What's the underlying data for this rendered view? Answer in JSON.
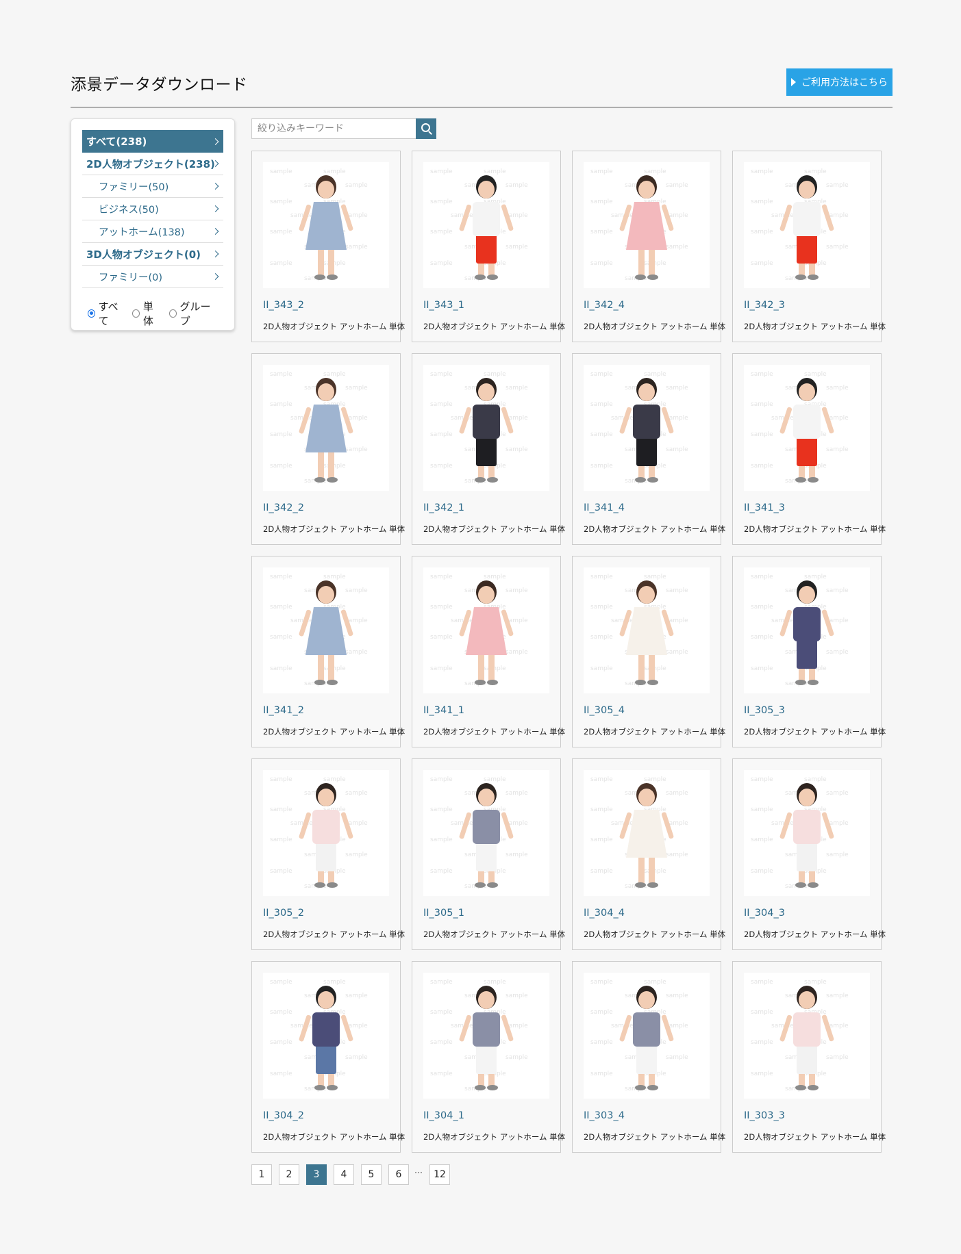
{
  "header": {
    "title": "添景データダウンロード",
    "help_label": "ご利用方法はこちら"
  },
  "sidebar": {
    "categories": [
      {
        "label": "すべて(238)",
        "level": "top",
        "active": true
      },
      {
        "label": "2D人物オブジェクト(238)",
        "level": "top",
        "active": false
      },
      {
        "label": "ファミリー(50)",
        "level": "sub",
        "active": false
      },
      {
        "label": "ビジネス(50)",
        "level": "sub",
        "active": false
      },
      {
        "label": "アットホーム(138)",
        "level": "sub",
        "active": false
      },
      {
        "label": "3D人物オブジェクト(0)",
        "level": "top",
        "active": false
      },
      {
        "label": "ファミリー(0)",
        "level": "sub",
        "active": false
      }
    ],
    "filters": [
      {
        "label": "すべて",
        "checked": true
      },
      {
        "label": "単体",
        "checked": false
      },
      {
        "label": "グループ",
        "checked": false
      }
    ]
  },
  "search": {
    "placeholder": "絞り込みキーワード",
    "value": ""
  },
  "items": [
    {
      "title": "II_343_2",
      "tags": "2D人物オブジェクト アットホーム 単体",
      "figure": {
        "top": "#9fb4d0",
        "bottom": "#9fb4d0",
        "skin": "#f2cdb4",
        "hair": "#4a3328",
        "dress": true
      }
    },
    {
      "title": "II_343_1",
      "tags": "2D人物オブジェクト アットホーム 単体",
      "figure": {
        "top": "#f4f4f4",
        "bottom": "#e8321e",
        "skin": "#f2cdb4",
        "hair": "#222222",
        "dress": false
      }
    },
    {
      "title": "II_342_4",
      "tags": "2D人物オブジェクト アットホーム 単体",
      "figure": {
        "top": "#f3b9bd",
        "bottom": "#e4c3b8",
        "skin": "#f2cdb4",
        "hair": "#3b2a22",
        "dress": true
      }
    },
    {
      "title": "II_342_3",
      "tags": "2D人物オブジェクト アットホーム 単体",
      "figure": {
        "top": "#f4f4f4",
        "bottom": "#e8321e",
        "skin": "#f2cdb4",
        "hair": "#222222",
        "dress": false
      }
    },
    {
      "title": "II_342_2",
      "tags": "2D人物オブジェクト アットホーム 単体",
      "figure": {
        "top": "#9fb4d0",
        "bottom": "#9fb4d0",
        "skin": "#f2cdb4",
        "hair": "#4a3328",
        "dress": true
      }
    },
    {
      "title": "II_342_1",
      "tags": "2D人物オブジェクト アットホーム 単体",
      "figure": {
        "top": "#3a3a48",
        "bottom": "#1e1e22",
        "skin": "#f2cdb4",
        "hair": "#2c2420",
        "dress": false
      }
    },
    {
      "title": "II_341_4",
      "tags": "2D人物オブジェクト アットホーム 単体",
      "figure": {
        "top": "#3a3a48",
        "bottom": "#1e1e22",
        "skin": "#f2cdb4",
        "hair": "#2c2420",
        "dress": false
      }
    },
    {
      "title": "II_341_3",
      "tags": "2D人物オブジェクト アットホーム 単体",
      "figure": {
        "top": "#f4f4f4",
        "bottom": "#e8321e",
        "skin": "#f2cdb4",
        "hair": "#222222",
        "dress": false
      }
    },
    {
      "title": "II_341_2",
      "tags": "2D人物オブジェクト アットホーム 単体",
      "figure": {
        "top": "#9fb4d0",
        "bottom": "#9fb4d0",
        "skin": "#f2cdb4",
        "hair": "#4a3328",
        "dress": true
      }
    },
    {
      "title": "II_341_1",
      "tags": "2D人物オブジェクト アットホーム 単体",
      "figure": {
        "top": "#f3b9bd",
        "bottom": "#e4c3b8",
        "skin": "#f2cdb4",
        "hair": "#3b2a22",
        "dress": true
      }
    },
    {
      "title": "II_305_4",
      "tags": "2D人物オブジェクト アットホーム 単体",
      "figure": {
        "top": "#f6f1ea",
        "bottom": "#e7c8b9",
        "skin": "#f2cdb4",
        "hair": "#4a3328",
        "dress": true
      }
    },
    {
      "title": "II_305_3",
      "tags": "2D人物オブジェクト アットホーム 単体",
      "figure": {
        "top": "#4b4d78",
        "bottom": "#4b4d78",
        "skin": "#f2cdb4",
        "hair": "#222222",
        "dress": false
      }
    },
    {
      "title": "II_305_2",
      "tags": "2D人物オブジェクト アットホーム 単体",
      "figure": {
        "top": "#f6dede",
        "bottom": "#f2f2f2",
        "skin": "#f2cdb4",
        "hair": "#2e2420",
        "dress": false
      }
    },
    {
      "title": "II_305_1",
      "tags": "2D人物オブジェクト アットホーム 単体",
      "figure": {
        "top": "#8a8fa6",
        "bottom": "#f4f4f4",
        "skin": "#f2cdb4",
        "hair": "#2c2420",
        "dress": false
      }
    },
    {
      "title": "II_304_4",
      "tags": "2D人物オブジェクト アットホーム 単体",
      "figure": {
        "top": "#f6f1ea",
        "bottom": "#e7c8b9",
        "skin": "#f2cdb4",
        "hair": "#4a3328",
        "dress": true
      }
    },
    {
      "title": "II_304_3",
      "tags": "2D人物オブジェクト アットホーム 単体",
      "figure": {
        "top": "#f6dede",
        "bottom": "#f2f2f2",
        "skin": "#f2cdb4",
        "hair": "#2e2420",
        "dress": false
      }
    },
    {
      "title": "II_304_2",
      "tags": "2D人物オブジェクト アットホーム 単体",
      "figure": {
        "top": "#4b4d78",
        "bottom": "#5b77a6",
        "skin": "#f2cdb4",
        "hair": "#222222",
        "dress": false
      }
    },
    {
      "title": "II_304_1",
      "tags": "2D人物オブジェクト アットホーム 単体",
      "figure": {
        "top": "#8a8fa6",
        "bottom": "#f4f4f4",
        "skin": "#f2cdb4",
        "hair": "#2c2420",
        "dress": false
      }
    },
    {
      "title": "II_303_4",
      "tags": "2D人物オブジェクト アットホーム 単体",
      "figure": {
        "top": "#8a8fa6",
        "bottom": "#f4f4f4",
        "skin": "#f2cdb4",
        "hair": "#2c2420",
        "dress": false
      }
    },
    {
      "title": "II_303_3",
      "tags": "2D人物オブジェクト アットホーム 単体",
      "figure": {
        "top": "#f6dede",
        "bottom": "#f2f2f2",
        "skin": "#f2cdb4",
        "hair": "#2e2420",
        "dress": false
      }
    }
  ],
  "pagination": {
    "pages": [
      "1",
      "2",
      "3",
      "4",
      "5",
      "6"
    ],
    "current": "3",
    "ellipsis": "…",
    "last": "12"
  },
  "colors": {
    "accent": "#3d7590",
    "help_button": "#29a3e6",
    "link": "#2d6a8a"
  }
}
